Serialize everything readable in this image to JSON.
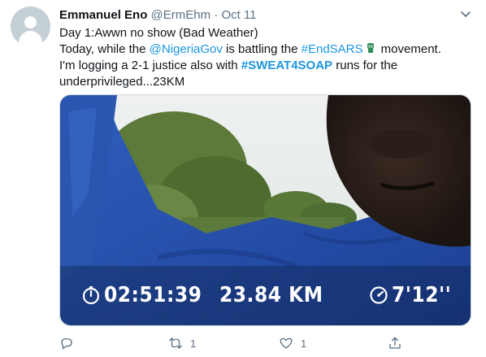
{
  "tweet": {
    "author_name": "Emmanuel Eno",
    "handle": "@ErmEhm",
    "separator": "·",
    "date": "Oct 11",
    "text": {
      "line1": "Day 1:Awwn no show (Bad Weather)",
      "line2_part1": "Today, while the ",
      "mention": "@NigeriaGov",
      "line2_part2": " is battling the ",
      "hashtag1": "#EndSARS",
      "line2_part3": " movement.",
      "line3_part1": "I'm logging a 2-1 justice also with ",
      "hashtag2": "#SWEAT4SOAP",
      "line3_part2": " runs for the",
      "line4": "underprivileged...23KM"
    },
    "media": {
      "duration": "02:51:39",
      "distance": "23.84 KM",
      "pace": "7'12''"
    },
    "actions": {
      "reply_count": "",
      "retweet_count": "1",
      "like_count": "1",
      "share_count": ""
    },
    "colors": {
      "link": "#1b95e0",
      "muted": "#5b7083",
      "text": "#0f1419"
    }
  }
}
